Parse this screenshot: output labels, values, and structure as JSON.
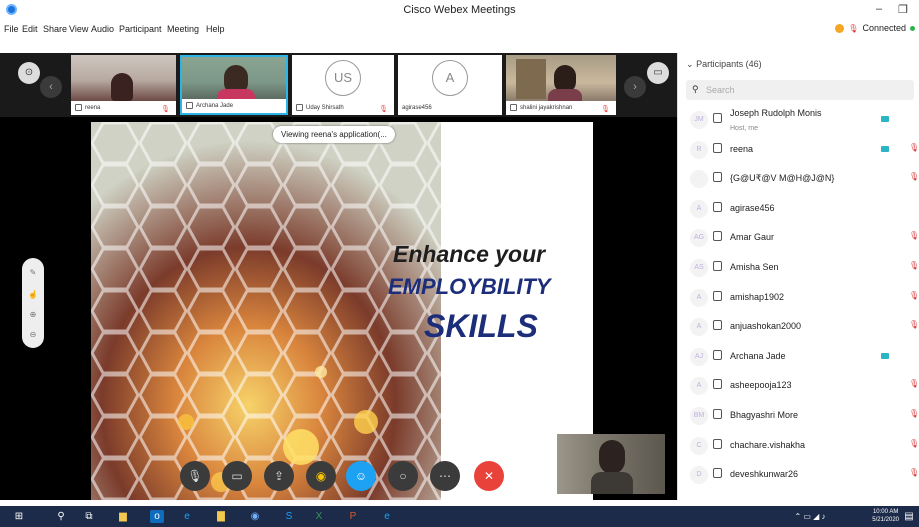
{
  "window": {
    "title": "Cisco Webex Meetings",
    "minimize": "–",
    "restore": "❐"
  },
  "menu": {
    "items": [
      "File",
      "Edit",
      "Share",
      "View",
      "Audio",
      "Participant",
      "Meeting",
      "Help"
    ],
    "status": "Connected"
  },
  "thumbnails": [
    {
      "name": "reena",
      "initials": ""
    },
    {
      "name": "Archana Jade",
      "initials": ""
    },
    {
      "name": "Uday Shirsath",
      "initials": "US"
    },
    {
      "name": "agirase456",
      "initials": "A"
    },
    {
      "name": "shalini jayakrishnan",
      "initials": ""
    }
  ],
  "share": {
    "tooltip": "Viewing reena's application(...",
    "line1": "Enhance your",
    "line2": "EMPLOYBILITY",
    "line3": "SKILLS"
  },
  "panel": {
    "header": "Participants (46)",
    "search_placeholder": "Search",
    "participants": [
      {
        "initials": "JM",
        "name": "Joseph Rudolph Monis",
        "sub": "Host, me",
        "cam": true,
        "muted": false
      },
      {
        "initials": "R",
        "name": "reena",
        "sub": "",
        "cam": true,
        "muted": true
      },
      {
        "initials": "",
        "name": "{G@U₹@V M@H@J@N}",
        "sub": "",
        "cam": false,
        "muted": true
      },
      {
        "initials": "A",
        "name": "agirase456",
        "sub": "",
        "cam": false,
        "muted": false
      },
      {
        "initials": "AG",
        "name": "Amar Gaur",
        "sub": "",
        "cam": false,
        "muted": true
      },
      {
        "initials": "AS",
        "name": "Amisha Sen",
        "sub": "",
        "cam": false,
        "muted": true
      },
      {
        "initials": "A",
        "name": "amishap1902",
        "sub": "",
        "cam": false,
        "muted": true
      },
      {
        "initials": "A",
        "name": "anjuashokan2000",
        "sub": "",
        "cam": false,
        "muted": true
      },
      {
        "initials": "AJ",
        "name": "Archana Jade",
        "sub": "",
        "cam": true,
        "muted": false
      },
      {
        "initials": "A",
        "name": "asheepooja123",
        "sub": "",
        "cam": false,
        "muted": true
      },
      {
        "initials": "BM",
        "name": "Bhagyashri More",
        "sub": "",
        "cam": false,
        "muted": true
      },
      {
        "initials": "C",
        "name": "chachare.vishakha",
        "sub": "",
        "cam": false,
        "muted": true
      },
      {
        "initials": "D",
        "name": "deveshkunwar26",
        "sub": "",
        "cam": false,
        "muted": true
      }
    ]
  },
  "taskbar": {
    "time": "10:00 AM",
    "date": "5/21/2020"
  },
  "colors": {
    "accent": "#1a73d9",
    "taskbar": "#1d2b4a",
    "mute": "#d33",
    "end": "#e8423a"
  }
}
